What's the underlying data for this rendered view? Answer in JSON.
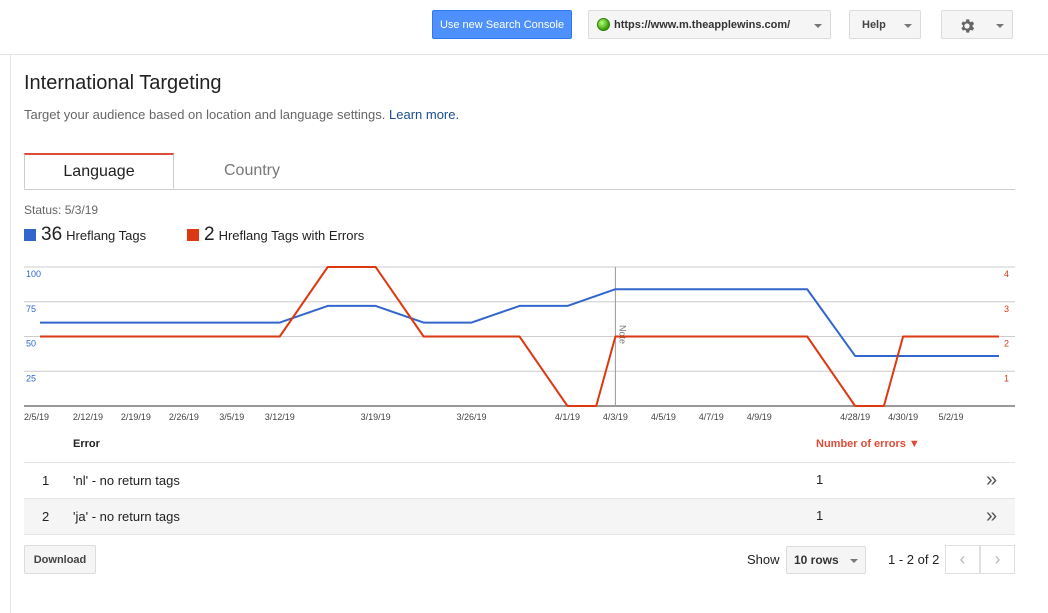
{
  "topbar": {
    "new_console_label": "Use new Search Console",
    "site_url": "https://www.m.theapplewins.com/",
    "help_label": "Help",
    "settings_icon": "gear-icon"
  },
  "page": {
    "title": "International Targeting",
    "subtitle": "Target your audience based on location and language settings.",
    "learn_more": "Learn more."
  },
  "tabs": [
    {
      "label": "Language",
      "active": true
    },
    {
      "label": "Country",
      "active": false
    }
  ],
  "status": "Status: 5/3/19",
  "legend": [
    {
      "count": "36",
      "label": "Hreflang Tags",
      "color": "#3366cc"
    },
    {
      "count": "2",
      "label": "Hreflang Tags with Errors",
      "color": "#dc3912"
    }
  ],
  "chart_data": {
    "type": "line",
    "x": [
      "2/5/19",
      "2/12/19",
      "2/19/19",
      "2/26/19",
      "3/5/19",
      "3/12/19",
      "3/16/19",
      "3/19/19",
      "3/23/19",
      "3/26/19",
      "3/30/19",
      "4/1/19",
      "4/3/19",
      "4/5/19",
      "4/7/19",
      "4/9/19",
      "4/26/19",
      "4/28/19",
      "4/30/19",
      "5/2/19",
      "5/3/19"
    ],
    "x_tick_labels": [
      "2/5/19",
      "2/12/19",
      "2/19/19",
      "2/26/19",
      "3/5/19",
      "3/12/19",
      "3/19/19",
      "3/26/19",
      "4/1/19",
      "4/3/19",
      "4/5/19",
      "4/7/19",
      "4/9/19",
      "4/28/19",
      "4/30/19",
      "5/2/19"
    ],
    "series": [
      {
        "name": "Hreflang Tags",
        "axis": "left",
        "color": "#3366cc",
        "points": [
          [
            0,
            60
          ],
          [
            5,
            60
          ],
          [
            6,
            72
          ],
          [
            7,
            72
          ],
          [
            8,
            60
          ],
          [
            9,
            60
          ],
          [
            10,
            72
          ],
          [
            11,
            72
          ],
          [
            12,
            84
          ],
          [
            15,
            84
          ],
          [
            16,
            84
          ],
          [
            17,
            36
          ],
          [
            18,
            36
          ],
          [
            19,
            36
          ],
          [
            20,
            36
          ]
        ]
      },
      {
        "name": "Hreflang Tags with Errors",
        "axis": "right",
        "color": "#dc3912",
        "points": [
          [
            0,
            2
          ],
          [
            5,
            2
          ],
          [
            6,
            4
          ],
          [
            7,
            4
          ],
          [
            8,
            2
          ],
          [
            9,
            2
          ],
          [
            10,
            2
          ],
          [
            11,
            0
          ],
          [
            11.6,
            0
          ],
          [
            12,
            2
          ],
          [
            15,
            2
          ],
          [
            16,
            2
          ],
          [
            17,
            0
          ],
          [
            17.6,
            0
          ],
          [
            18,
            2
          ],
          [
            20,
            2
          ]
        ]
      }
    ],
    "y_left_ticks": [
      "100",
      "75",
      "50",
      "25"
    ],
    "y_right_ticks": [
      "4",
      "3",
      "2",
      "1"
    ],
    "ylim_left": [
      0,
      100
    ],
    "ylim_right": [
      0,
      4
    ],
    "annotation": {
      "x_label": "4/3/19",
      "text": "Note"
    },
    "grid": true
  },
  "table": {
    "headers": {
      "error": "Error",
      "count": "Number of errors ▼"
    },
    "rows": [
      {
        "index": "1",
        "error": "'nl' - no return tags",
        "count": "1"
      },
      {
        "index": "2",
        "error": "'ja' - no return tags",
        "count": "1"
      }
    ]
  },
  "footer": {
    "download_label": "Download",
    "show_label": "Show",
    "rows_value": "10 rows",
    "pager_info": "1 - 2 of 2"
  }
}
